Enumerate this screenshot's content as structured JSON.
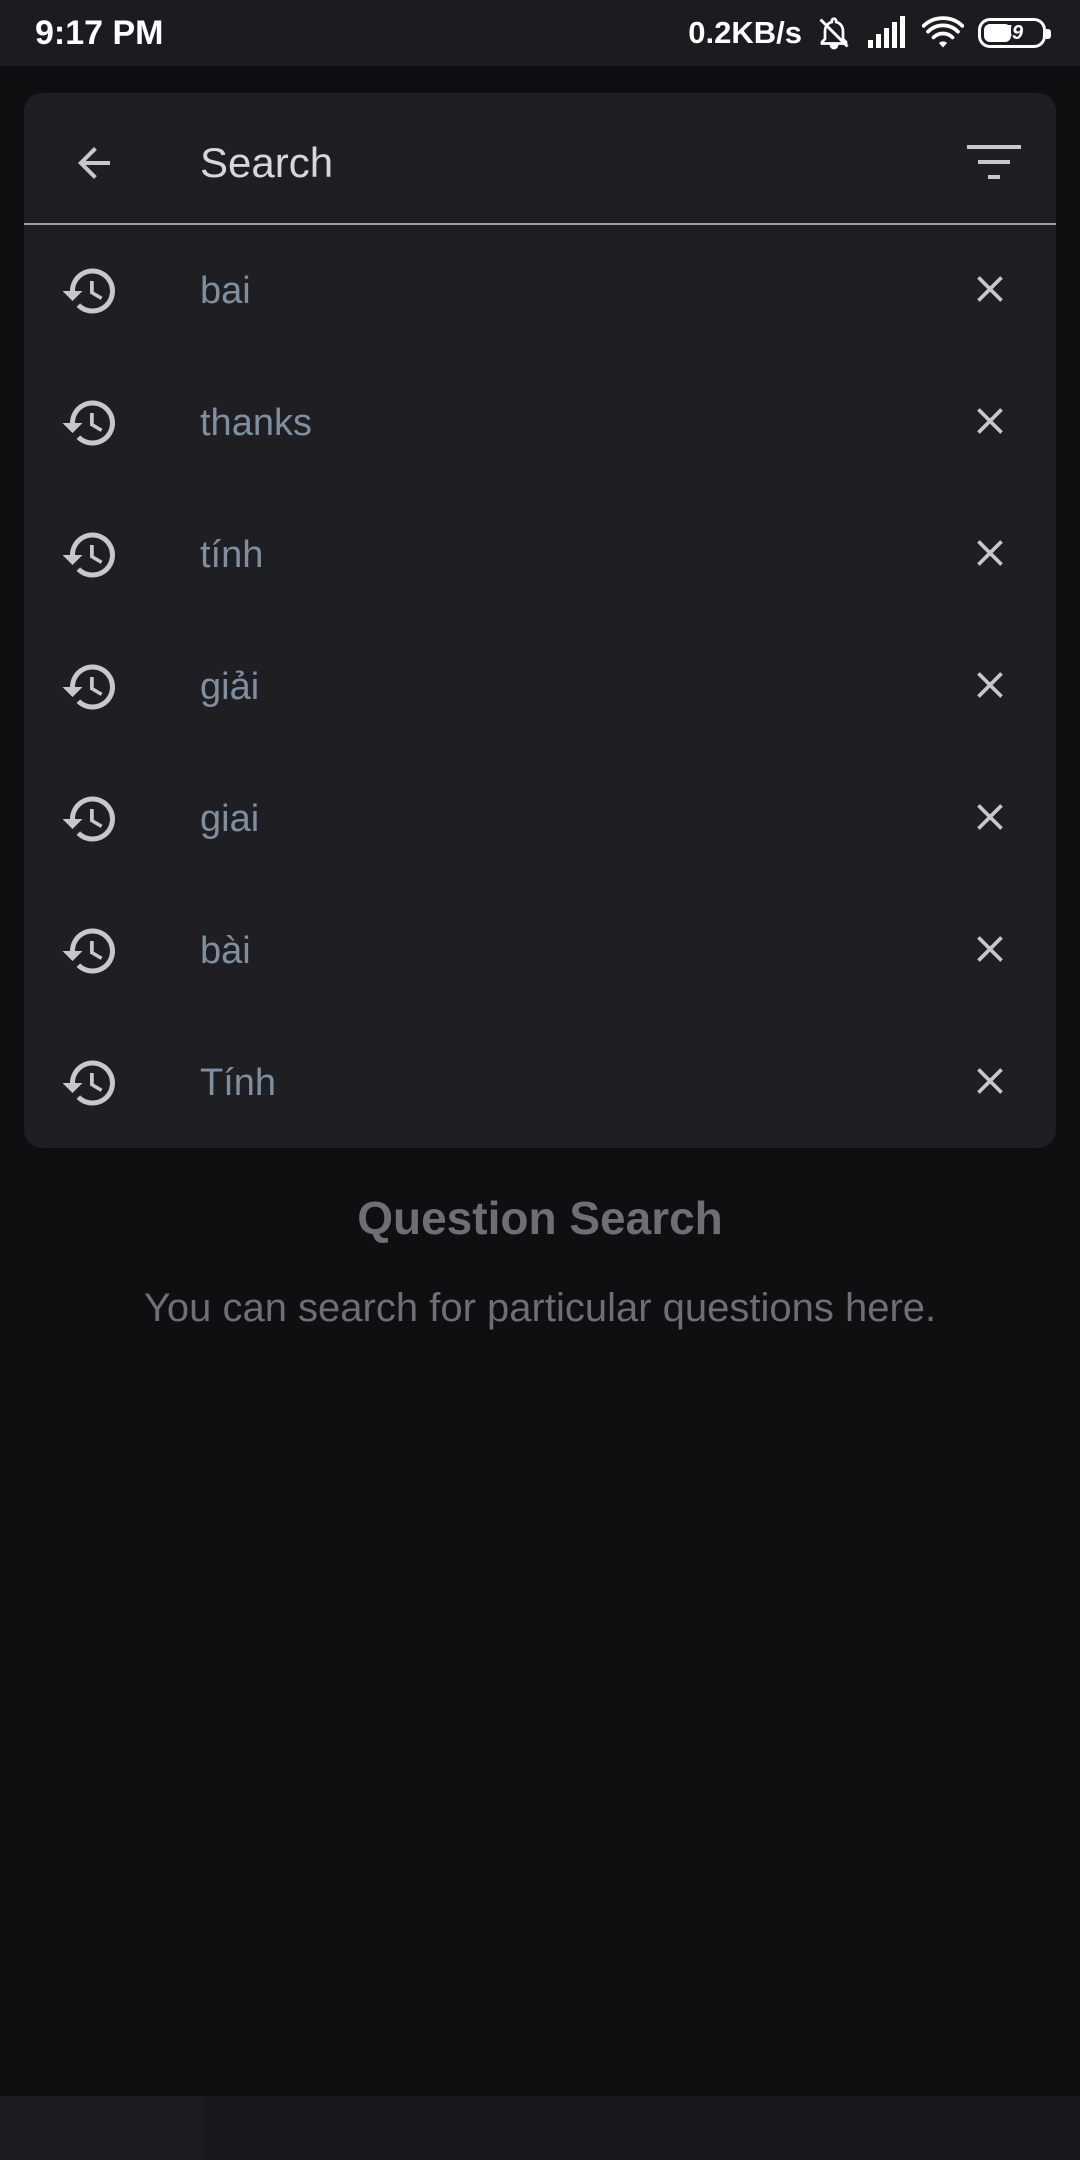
{
  "status_bar": {
    "time": "9:17 PM",
    "net_speed": "0.2KB/s",
    "battery": "49",
    "icons": [
      "mute-bell-icon",
      "signal-icon",
      "wifi-icon",
      "battery-icon"
    ]
  },
  "search": {
    "title": "Search",
    "back_icon": "arrow-left-icon",
    "filter_icon": "filter-icon"
  },
  "history": {
    "item_icon": "history-icon",
    "remove_icon": "close-icon",
    "items": [
      {
        "text": "bai"
      },
      {
        "text": "thanks"
      },
      {
        "text": "tính"
      },
      {
        "text": "giải"
      },
      {
        "text": "giai"
      },
      {
        "text": "bài"
      },
      {
        "text": "Tính"
      }
    ]
  },
  "empty_state": {
    "title": "Question Search",
    "description": "You can search for particular questions here."
  },
  "colors": {
    "background": "#0f0f11",
    "card": "#1f1e23",
    "history_text": "#7f8fa0",
    "icon": "#c8c8cc",
    "muted_text": "#6e6e73"
  }
}
